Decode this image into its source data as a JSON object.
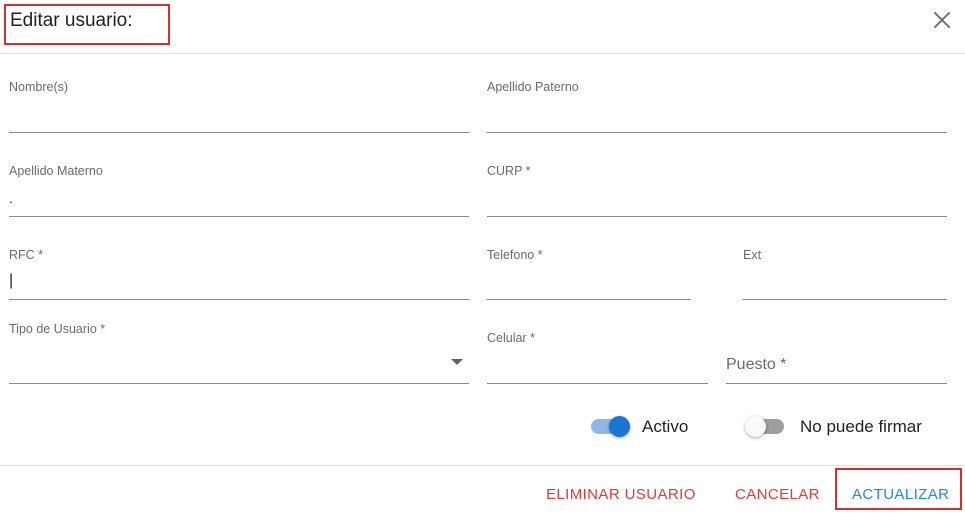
{
  "dialog": {
    "title": "Editar usuario:",
    "close_icon": "close-icon"
  },
  "fields": {
    "nombres": {
      "label": "Nombre(s)",
      "value": ""
    },
    "apellido_paterno": {
      "label": "Apellido Paterno",
      "value": ""
    },
    "apellido_materno": {
      "label": "Apellido Materno",
      "value": "."
    },
    "curp": {
      "label": "CURP *",
      "value": ""
    },
    "rfc": {
      "label": "RFC *",
      "value": "|"
    },
    "telefono": {
      "label": "Telefono *",
      "value": ""
    },
    "ext": {
      "label": "Ext",
      "value": ""
    },
    "tipo_usuario": {
      "label": "Tipo de Usuario *",
      "value": "",
      "icon": "dropdown-arrow-icon"
    },
    "celular": {
      "label": "Celular *",
      "value": ""
    },
    "puesto": {
      "placeholder": "Puesto *",
      "value": ""
    }
  },
  "toggles": {
    "activo": {
      "label": "Activo",
      "checked": true,
      "accent": "#1976d2"
    },
    "no_puede_firmar": {
      "label": "No puede firmar",
      "checked": false
    }
  },
  "footer": {
    "delete_label": "ELIMINAR USUARIO",
    "cancel_label": "CANCELAR",
    "update_label": "ACTUALIZAR"
  },
  "colors": {
    "danger": "#e53935",
    "primary": "#1e88e5",
    "highlight_box": "#d32f2f"
  }
}
